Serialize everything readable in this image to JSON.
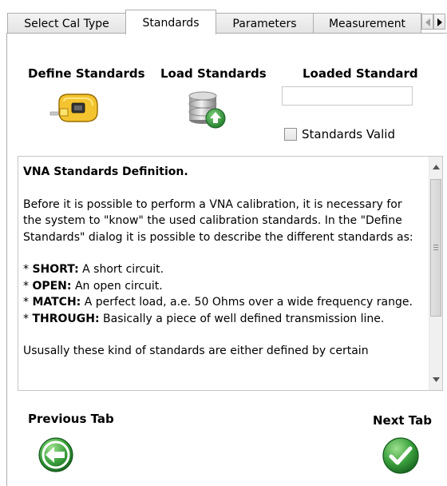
{
  "tabs": [
    {
      "label": "Select Cal Type",
      "active": false
    },
    {
      "label": "Standards",
      "active": true
    },
    {
      "label": "Parameters",
      "active": false
    },
    {
      "label": "Measurement",
      "active": false
    }
  ],
  "sections": {
    "define_label": "Define Standards",
    "load_label": "Load Standards",
    "loaded_label": "Loaded Standard",
    "loaded_value": "",
    "valid_label": "Standards Valid",
    "valid_checked": false
  },
  "description": {
    "title": "VNA Standards Definition.",
    "intro": "Before it is possible to perform a VNA calibration, it is necessary for the system to \"know\" the used calibration standards. In the \"Define Standards\" dialog it is possible to describe the different standards as:",
    "items": [
      {
        "term": "SHORT:",
        "text": "A short circuit."
      },
      {
        "term": "OPEN:",
        "text": "An open circuit."
      },
      {
        "term": "MATCH:",
        "text": "A perfect load, a.e. 50 Ohms over a wide frequency range."
      },
      {
        "term": "THROUGH:",
        "text": "Basically a piece of well defined transmission line."
      }
    ],
    "bullet": "* ",
    "outro": "Ususally these kind of standards are either defined by certain"
  },
  "nav": {
    "previous_label": "Previous Tab",
    "next_label": "Next Tab"
  },
  "colors": {
    "previous_icon": "#3da33f",
    "next_icon": "#3da33f",
    "tab_border": "#adadad"
  }
}
